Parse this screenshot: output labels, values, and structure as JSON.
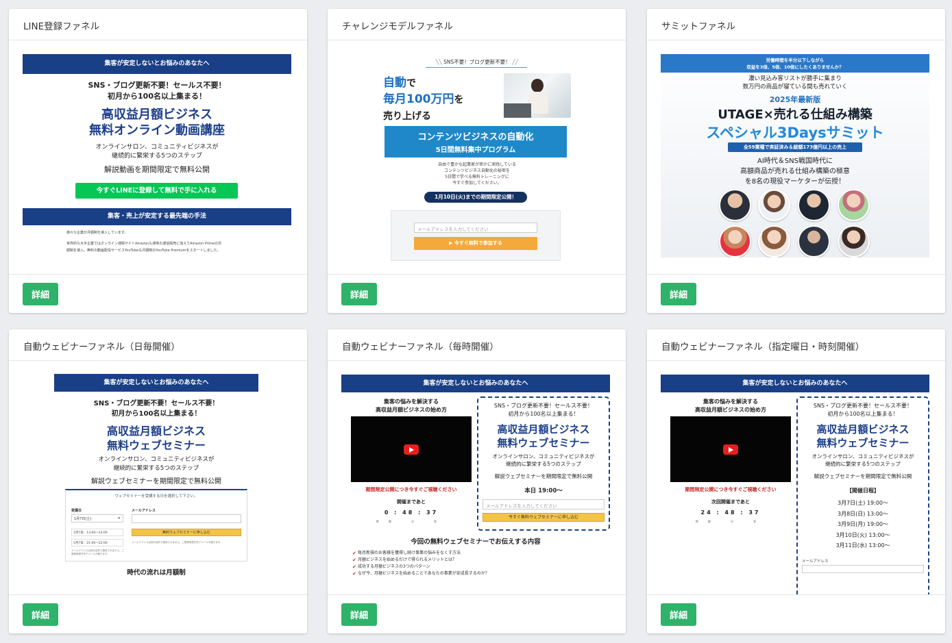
{
  "cards": [
    {
      "title": "LINE登録ファネル",
      "detail_label": "詳細",
      "preview": {
        "top_banner": "集客が安定しないとお悩みのあなたへ",
        "lead1": "SNS・ブログ更新不要！セールス不要！",
        "lead2": "初月から100名以上集まる！",
        "headline1": "高収益月額ビジネス",
        "headline2": "無料オンライン動画講座",
        "desc1": "オンラインサロン、コミュニティビジネスが",
        "desc2": "継続的に繁栄する5つのステップ",
        "desc3": "解説動画を期間限定で無料公開",
        "cta": "今すぐLINEに登録して無料で手に入れる",
        "section_banner": "集客・売上が安定する最先端の手法",
        "body1": "様々な企業が月額制を導入しています。",
        "body2": "世界的な大手企業ではオンライン通販サイトAmazonも通常の通信販売に加えてAmazon Primeの月",
        "body3": "額制を導入。無料の動画配信サービスYouTubeも月額制のYouTube Premiumをスタートしました。"
      }
    },
    {
      "title": "チャレンジモデルファネル",
      "detail_label": "詳細",
      "preview": {
        "tagline": "SNS不要！ブログ更新不要！",
        "hl_a1": "自動",
        "hl_a2": "で",
        "hl_b1": "毎月100万円",
        "hl_b2": "を",
        "hl_c": "売り上げる",
        "box1": "コンテンツビジネスの自動化",
        "box2": "5日間無料集中プログラム",
        "desc1": "自由で豊かな起業家が密かに実践している",
        "desc2": "コンテンツビジネス自動化の秘密を",
        "desc3": "5日間で学べる無料トレーニングに",
        "desc4": "今すぐ参加してください。",
        "pill": "1月10日(火)までの期間限定公開！",
        "email_placeholder": "メールアドレスを入力してください",
        "cta": "▶ 今すぐ無料で参加する"
      }
    },
    {
      "title": "サミットファネル",
      "detail_label": "詳細",
      "preview": {
        "top1": "労働時間を半分以下しながら",
        "top2": "収益を3倍、5倍、10倍にしたくありませんか？",
        "sub1": "濃い見込み客リストが勝手に集まり",
        "sub2": "数万円の商品が寝ている間も売れていく",
        "year": "2025年最新版",
        "main1": "UTAGE×売れる仕組み構築",
        "main2": "スペシャル3Daysサミット",
        "ribbon": "全59業種で実証済み＆総額173億円以上の売上",
        "lead1": "AI時代＆SNS戦国時代に",
        "lead2": "高額商品が売れる仕組み構築の極意",
        "lead3": "を8名の現役マーケターが伝授！"
      }
    },
    {
      "title": "自動ウェビナーファネル（日毎開催）",
      "detail_label": "詳細",
      "preview": {
        "top_banner": "集客が安定しないとお悩みのあなたへ",
        "lead1": "SNS・ブログ更新不要！セールス不要！",
        "lead2": "初月から100名以上集まる！",
        "headline1": "高収益月額ビジネス",
        "headline2": "無料ウェブセミナー",
        "desc1": "オンラインサロン、コミュニティビジネスが",
        "desc2": "継続的に繁栄する5つのステップ",
        "desc3": "解説ウェブセミナーを期間限定で無料公開",
        "form_title": "ウェブセミナーを受講する日を選択して下さい。",
        "date_label": "受講日",
        "date_value": "1月7日(土)",
        "email_label": "メールアドレス",
        "time1": "1月7日：13:00〜13:00",
        "time2": "1月7日：21:00〜22:00",
        "submit": "無料ウェブセミナーに申し込む",
        "note": "メールアドレスは他の目的で使用されません。ご登録後受付完了メールが届きます。",
        "bottom": "時代の流れは月額制"
      }
    },
    {
      "title": "自動ウェビナーファネル（毎時開催）",
      "detail_label": "詳細",
      "preview": {
        "top_banner": "集客が安定しないとお悩みのあなたへ",
        "video_title1": "集客の悩みを解決する",
        "video_title2": "高収益月額ビジネスの始め方",
        "limited_note": "期間限定公開につき今すぐご視聴ください",
        "countdown_label": "開催まであと",
        "countdown": "0 : 48 : 37",
        "countdown_units": "時間 分 秒",
        "box_lead1": "SNS・ブログ更新不要！セールス不要！",
        "box_lead2": "初月から100名以上集まる！",
        "box_h1": "高収益月額ビジネス",
        "box_h2": "無料ウェブセミナー",
        "box_desc1": "オンラインサロン、コミュニティビジネスが",
        "box_desc2": "継続的に繁栄する5つのステップ",
        "box_desc3": "解説ウェブセミナーを期間限定で無料公開",
        "box_time": "本日 19:00〜",
        "email_placeholder": "メールアドレスを入力してください",
        "submit": "今すぐ無料ウェブセミナーに申し込む",
        "content_title": "今回の無料ウェブセミナーでお伝えする内容",
        "items": [
          "毎月新規のお客様を獲得し続け事業の悩みをなくす方法",
          "月額ビジネスを始めるだけで得られるメリットとは？",
          "成功する月額ビジネスの3つのパターン",
          "なぜ今、月額ビジネスを始めることであなたの事業が安成長するのか？"
        ]
      }
    },
    {
      "title": "自動ウェビナーファネル（指定曜日・時刻開催）",
      "detail_label": "詳細",
      "preview": {
        "top_banner": "集客が安定しないとお悩みのあなたへ",
        "video_title1": "集客の悩みを解決する",
        "video_title2": "高収益月額ビジネスの始め方",
        "limited_note": "期間限定公開につき今すぐご視聴ください",
        "countdown_label": "次回開催まであと",
        "countdown": "24 : 48 : 37",
        "countdown_units": "時間 分 秒",
        "box_lead1": "SNS・ブログ更新不要！セールス不要！",
        "box_lead2": "初月から100名以上集まる！",
        "box_h1": "高収益月額ビジネス",
        "box_h2": "無料ウェブセミナー",
        "box_desc1": "オンラインサロン、コミュニティビジネスが",
        "box_desc2": "継続的に繁栄する5つのステップ",
        "box_desc3": "解説ウェブセミナーを期間限定で無料公開",
        "schedule_title": "【開催日程】",
        "schedule": [
          "3月7日(土) 19:00〜",
          "3月8日(日) 13:00〜",
          "3月9日(月) 19:00〜",
          "3月10日(火) 13:00〜",
          "3月11日(水) 13:00〜"
        ],
        "email_label": "メールアドレス"
      }
    }
  ],
  "colors": {
    "navy": "#193f86",
    "green_button": "#2fb26a",
    "line_green": "#06c755",
    "blue_box": "#1f88c9",
    "orange_cta": "#f4a93a",
    "red_accent": "#c0211f"
  }
}
